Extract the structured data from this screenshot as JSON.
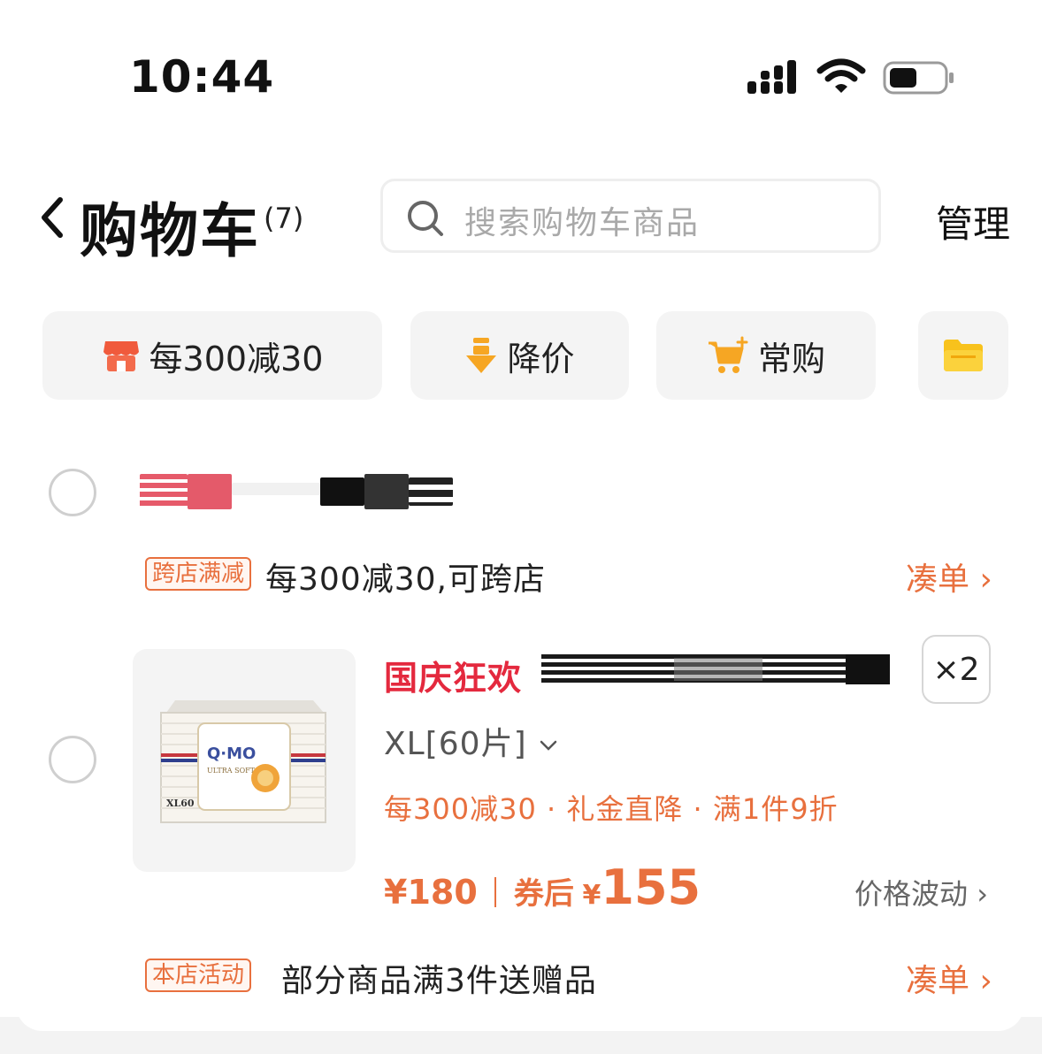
{
  "status_bar": {
    "time": "10:44"
  },
  "header": {
    "title": "购物车",
    "count": "(7)",
    "search_placeholder": "搜索购物车商品",
    "manage_label": "管理"
  },
  "chips": [
    {
      "label": "每300减30",
      "icon": "store-icon"
    },
    {
      "label": "降价",
      "icon": "price-drop-icon"
    },
    {
      "label": "常购",
      "icon": "cart-plus-icon"
    },
    {
      "label": "",
      "icon": "folder-icon"
    }
  ],
  "store": {
    "promo_tag": "跨店满减",
    "promo_text": "每300减30,可跨店",
    "collect_label": "凑单"
  },
  "product": {
    "festival_label": "国庆狂欢",
    "quantity": "×2",
    "spec": "XL[60片]",
    "promos": "每300减30 · 礼金直降 · 满1件9折",
    "price": "¥180",
    "after_coupon_label": "券后",
    "after_coupon_currency": "¥",
    "after_coupon_price": "155",
    "price_fluct_label": "价格波动",
    "image_brand": "Q·MO"
  },
  "store_activity": {
    "tag": "本店活动",
    "text": "部分商品满3件送赠品",
    "collect_label": "凑单"
  },
  "colors": {
    "accent": "#e8703e",
    "festival": "#e4293e",
    "chip_bg": "#f4f4f4"
  }
}
